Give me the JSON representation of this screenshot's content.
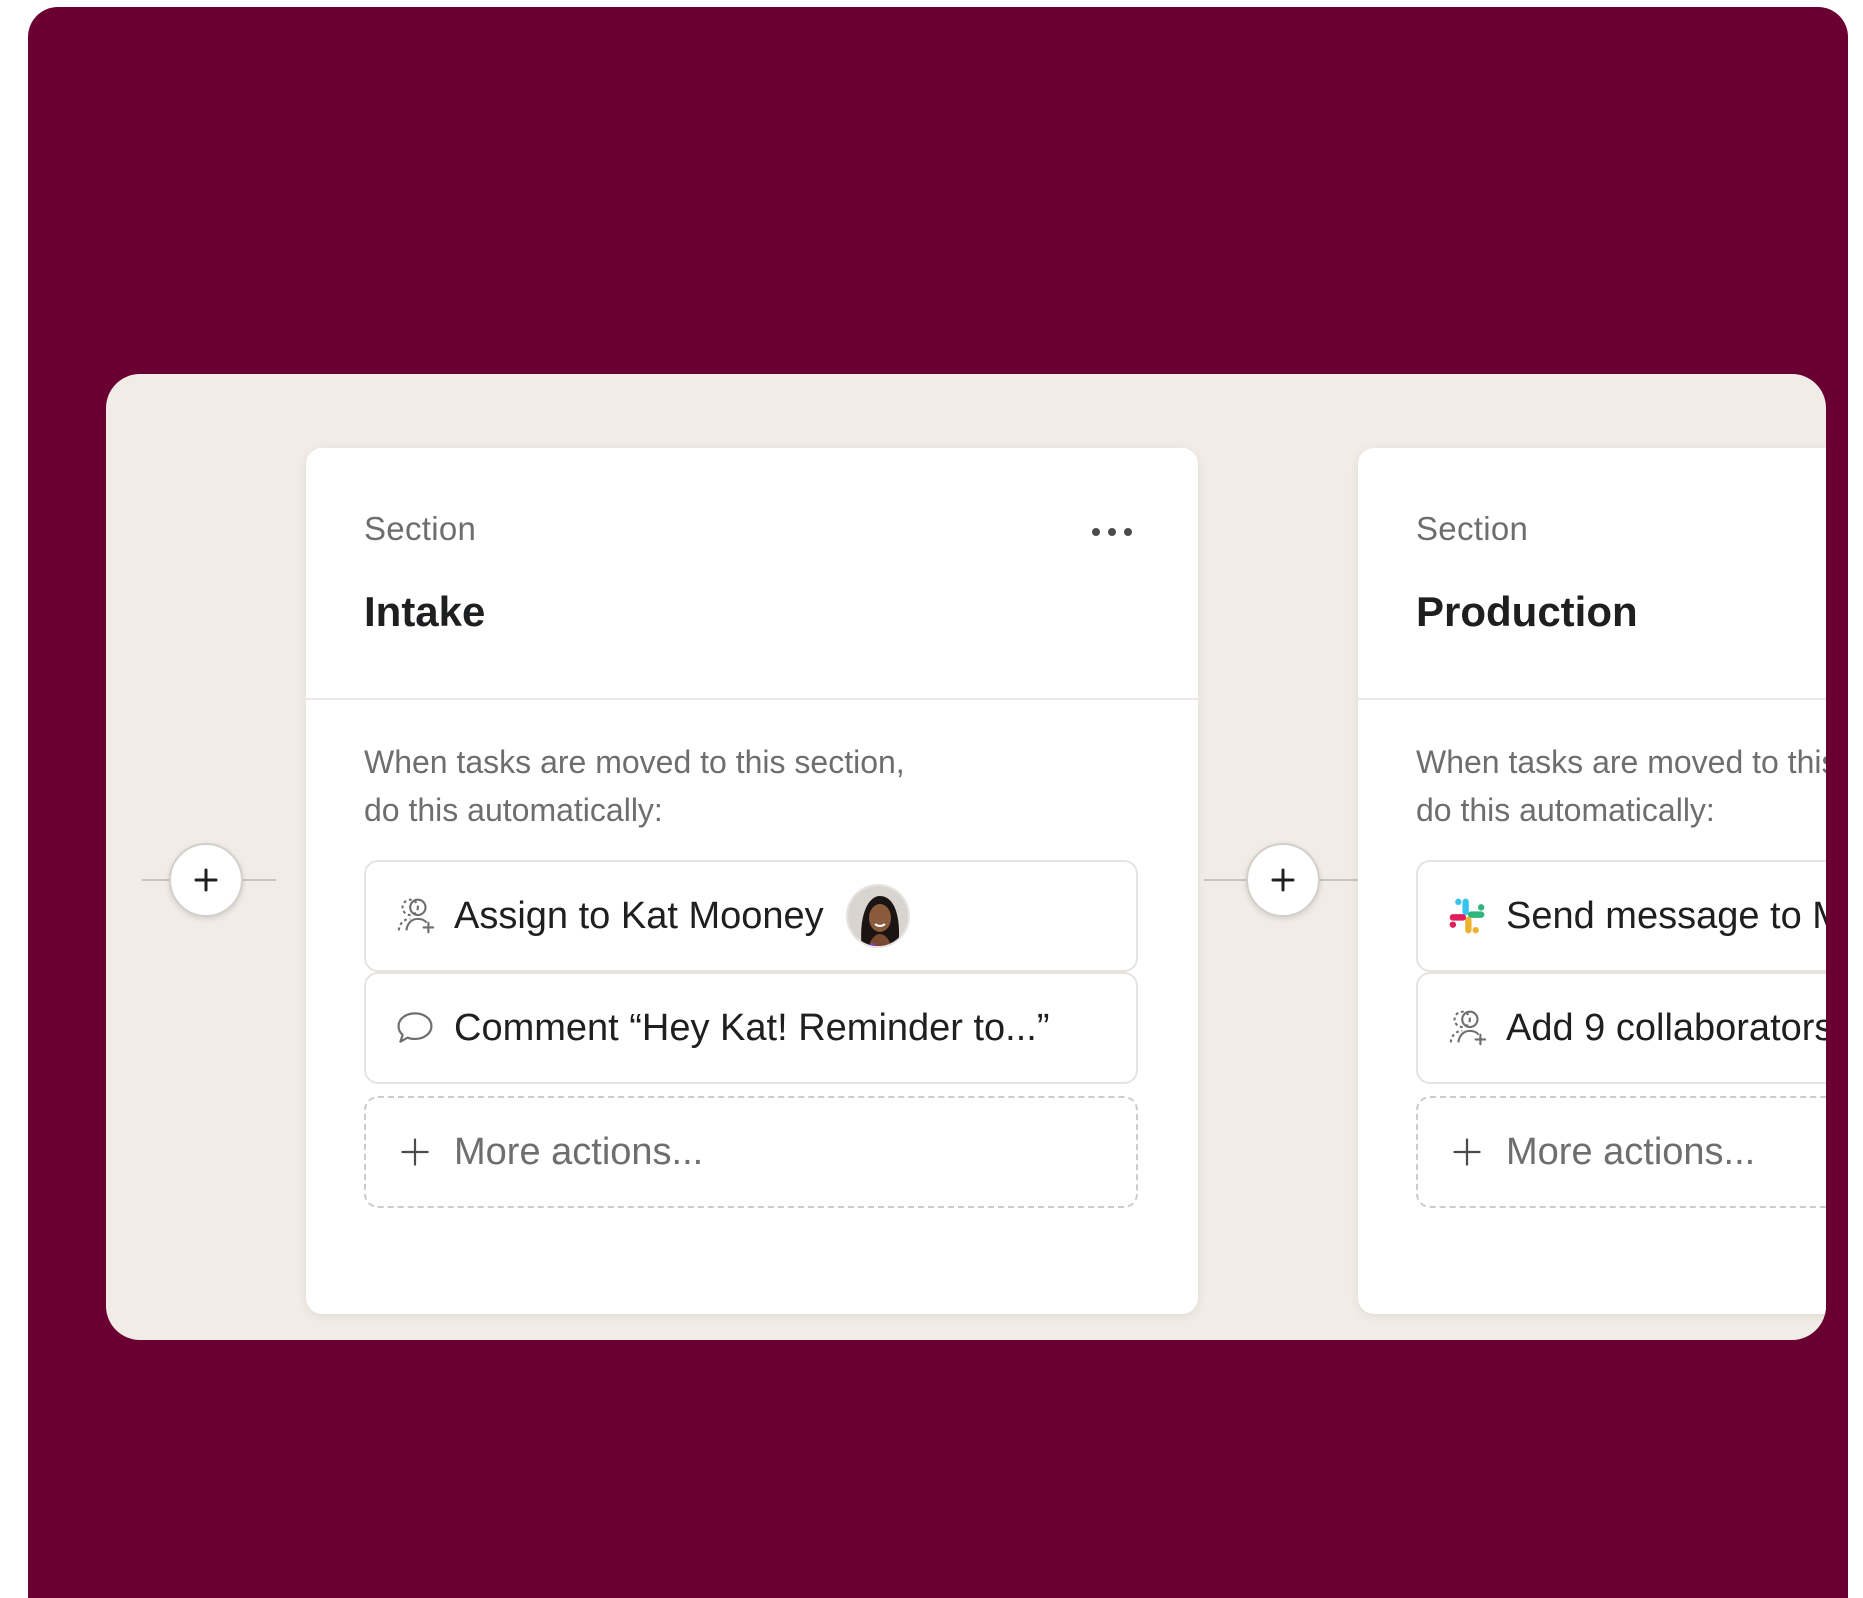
{
  "sections": [
    {
      "label": "Section",
      "title": "Intake",
      "menu_icon": "more-horizontal-icon",
      "rule_text_line1": "When tasks are moved to this section,",
      "rule_text_line2": "do this automatically:",
      "actions": [
        {
          "icon": "assign-user-icon",
          "label": "Assign to Kat Mooney",
          "avatar": "kat-mooney-avatar"
        },
        {
          "icon": "comment-icon",
          "label": "Comment “Hey Kat! Reminder to...”"
        }
      ],
      "more_actions": {
        "icon": "plus-icon",
        "label": "More actions..."
      }
    },
    {
      "label": "Section",
      "title": "Production",
      "rule_text_line1": "When tasks are moved to this section,",
      "rule_text_line2": "do this automatically:",
      "actions": [
        {
          "icon": "slack-icon",
          "label": "Send message to M"
        },
        {
          "icon": "add-collaborators-icon",
          "label": "Add 9 collaborators"
        }
      ],
      "more_actions": {
        "icon": "plus-icon",
        "label": "More actions..."
      }
    }
  ],
  "add_section_buttons": [
    "plus-icon",
    "plus-icon"
  ],
  "colors": {
    "outer_background": "#6a0032",
    "panel_background": "#f1ece6",
    "card_background": "#ffffff",
    "primary_text": "#1e1f21",
    "secondary_text": "#6d6e6f"
  }
}
